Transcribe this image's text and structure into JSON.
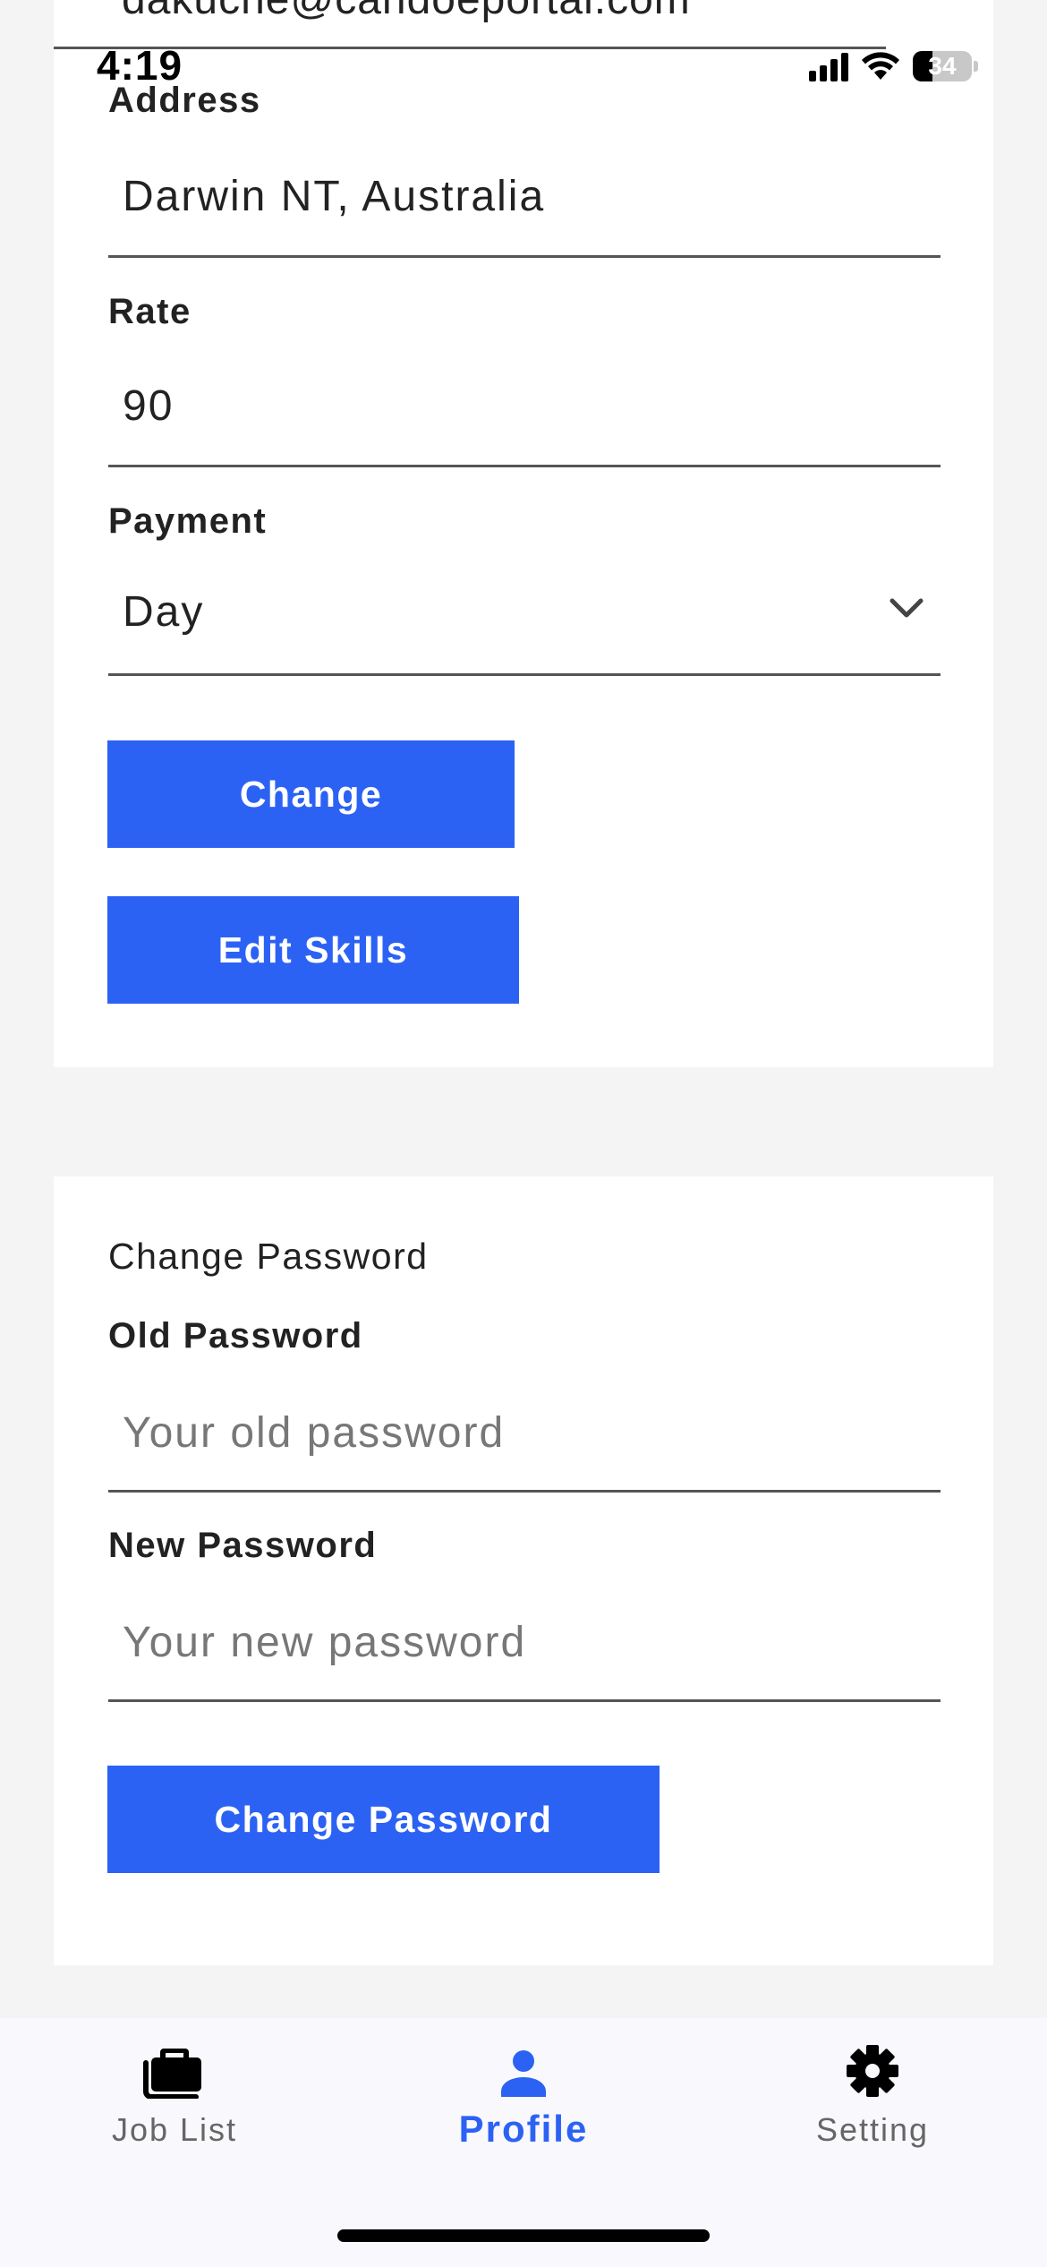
{
  "status_bar": {
    "time": "4:19",
    "battery_level": "34",
    "battery_fraction": 0.34
  },
  "profile_form": {
    "email_partial": "dakuche@candoeportal.com",
    "address": {
      "label": "Address",
      "value": "Darwin NT, Australia"
    },
    "rate": {
      "label": "Rate",
      "value": "90"
    },
    "payment": {
      "label": "Payment",
      "value": "Day",
      "icon": "chevron-down-icon"
    },
    "change_button": "Change",
    "edit_skills_button": "Edit Skills"
  },
  "password_form": {
    "title": "Change Password",
    "old_password": {
      "label": "Old Password",
      "placeholder": "Your old password"
    },
    "new_password": {
      "label": "New Password",
      "placeholder": "Your new password"
    },
    "submit_button": "Change Password"
  },
  "tab_bar": {
    "active": "profile",
    "tabs": [
      {
        "id": "jobs",
        "label": "Job List",
        "icon": "briefcase-icon"
      },
      {
        "id": "profile",
        "label": "Profile",
        "icon": "person-icon"
      },
      {
        "id": "setting",
        "label": "Setting",
        "icon": "gear-icon"
      }
    ]
  },
  "colors": {
    "accent": "#2c62f4",
    "background": "#f4f4f4",
    "card": "#ffffff",
    "text": "#222222"
  }
}
